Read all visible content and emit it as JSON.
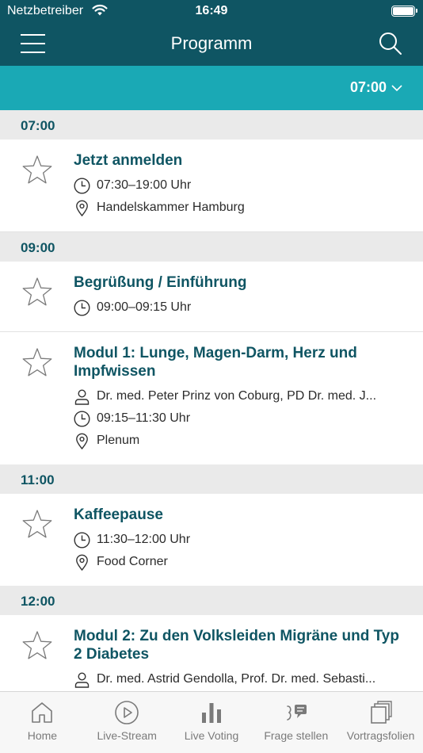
{
  "status": {
    "carrier": "Netzbetreiber",
    "time": "16:49"
  },
  "nav": {
    "title": "Programm"
  },
  "time_selector": {
    "value": "07:00"
  },
  "sections": [
    {
      "time": "07:00",
      "items": [
        {
          "title": "Jetzt anmelden",
          "time": "07:30–19:00 Uhr",
          "location": "Handelskammer Hamburg"
        }
      ]
    },
    {
      "time": "09:00",
      "items": [
        {
          "title": "Begrüßung / Einführung",
          "time": "09:00–09:15 Uhr"
        },
        {
          "title": "Modul 1: Lunge, Magen-Darm, Herz und Impfwissen",
          "speakers": "Dr. med. Peter Prinz von Coburg, PD Dr. med. J...",
          "time": "09:15–11:30 Uhr",
          "location": "Plenum"
        }
      ]
    },
    {
      "time": "11:00",
      "items": [
        {
          "title": "Kaffeepause",
          "time": "11:30–12:00 Uhr",
          "location": "Food Corner"
        }
      ]
    },
    {
      "time": "12:00",
      "items": [
        {
          "title": "Modul 2: Zu den Volksleiden Migräne und Typ 2 Diabetes",
          "speakers": "Dr. med. Astrid Gendolla, Prof. Dr. med. Sebasti..."
        }
      ]
    }
  ],
  "tabs": [
    {
      "label": "Home",
      "icon": "home-icon"
    },
    {
      "label": "Live-Stream",
      "icon": "play-icon"
    },
    {
      "label": "Live Voting",
      "icon": "bar-chart-icon"
    },
    {
      "label": "Frage stellen",
      "icon": "ask-question-icon"
    },
    {
      "label": "Vortragsfolien",
      "icon": "slides-icon"
    }
  ],
  "colors": {
    "header": "#0f5563",
    "accent": "#1aa9b5",
    "title": "#0f5563",
    "section_bg": "#eaeaea"
  }
}
